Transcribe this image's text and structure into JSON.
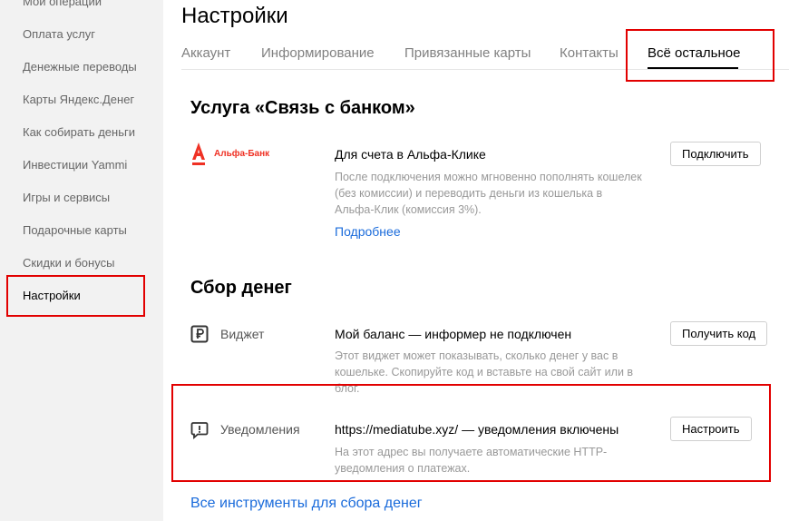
{
  "sidebar": {
    "items": [
      {
        "label": "Мои операции"
      },
      {
        "label": "Оплата услуг"
      },
      {
        "label": "Денежные переводы"
      },
      {
        "label": "Карты Яндекс.Денег"
      },
      {
        "label": "Как собирать деньги"
      },
      {
        "label": "Инвестиции Yammi"
      },
      {
        "label": "Игры и сервисы"
      },
      {
        "label": "Подарочные карты"
      },
      {
        "label": "Скидки и бонусы"
      },
      {
        "label": "Настройки"
      }
    ],
    "active_index": 9
  },
  "header": {
    "title": "Настройки",
    "tabs": [
      {
        "label": "Аккаунт"
      },
      {
        "label": "Информирование"
      },
      {
        "label": "Привязанные карты"
      },
      {
        "label": "Контакты"
      },
      {
        "label": "Всё остальное"
      }
    ],
    "active_tab_index": 4
  },
  "bank_section": {
    "title": "Услуга «Связь с банком»",
    "bank_logo_text": "Альфа-Банк",
    "item_title": "Для счета в Альфа-Клике",
    "description": "После подключения можно мгновенно пополнять кошелек (без комиссии) и переводить деньги из кошелька в Альфа-Клик (комиссия 3%).",
    "more_link": "Подробнее",
    "connect_button": "Подключить"
  },
  "collect_section": {
    "title": "Сбор денег",
    "widget": {
      "icon": "ruble-icon",
      "label": "Виджет",
      "title": "Мой баланс — информер не подключен",
      "description": "Этот виджет может показывать, сколько денег у вас в кошельке. Скопируйте код и вставьте на свой сайт или в блог.",
      "button": "Получить код"
    },
    "notifications": {
      "icon": "speech-bubble-icon",
      "label": "Уведомления",
      "title": "https://mediatube.xyz/ — уведомления включены",
      "description": "На этот адрес вы получаете автоматические HTTP-уведомления о платежах.",
      "button": "Настроить"
    },
    "all_tools_link": "Все инструменты для сбора денег"
  },
  "colors": {
    "sidebar_bg": "#f2f2f2",
    "link": "#1a6bdb",
    "alfa_red": "#ef3124",
    "highlight_red": "#e20000"
  }
}
